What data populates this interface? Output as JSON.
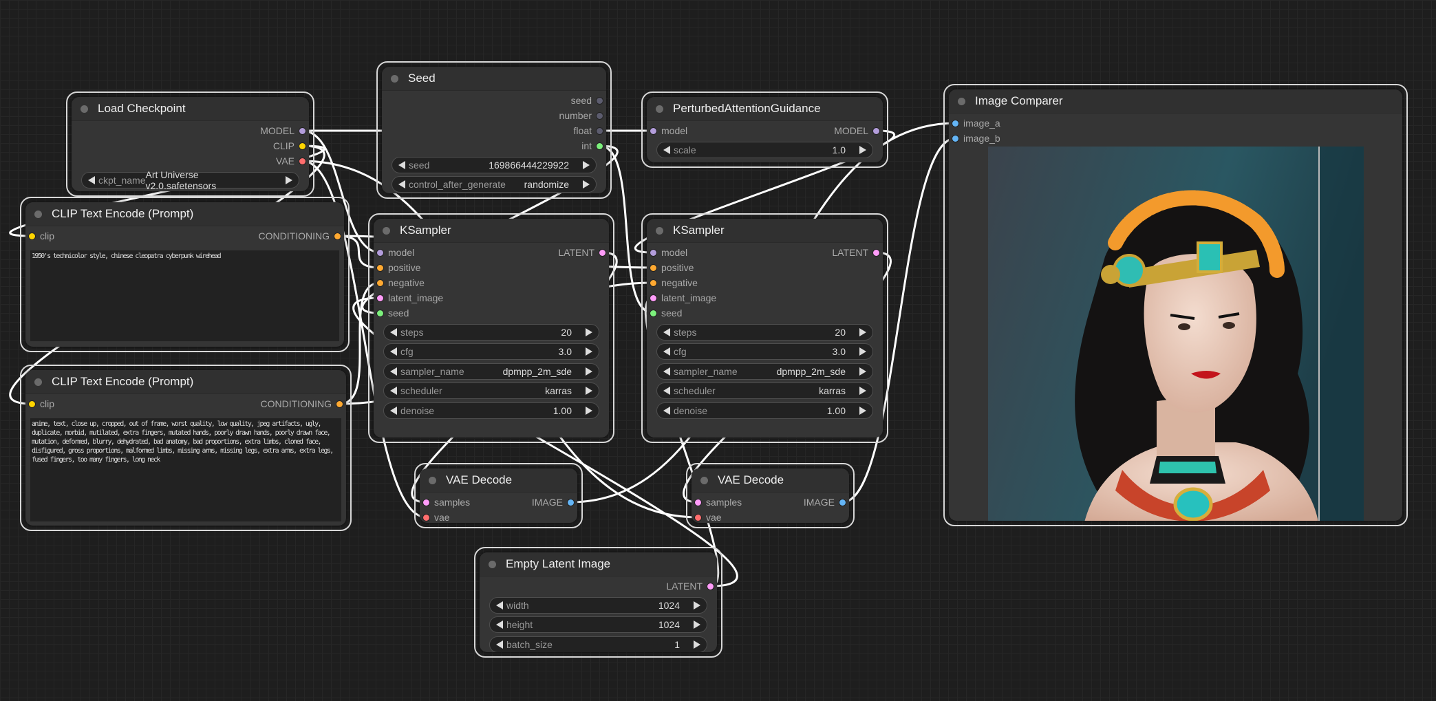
{
  "colors": {
    "MODEL": "#b39ddb",
    "CLIP": "#ffd500",
    "VAE": "#ff6e6e",
    "CONDITIONING": "#ffa931",
    "LATENT": "#ff9cf9",
    "IMAGE": "#64b5f6",
    "INT": "#7cf07c",
    "NUMBER": "#5c5c6e",
    "wire": "#ffffff",
    "canvas": "#1e1e1e"
  },
  "nodes": [
    {
      "id": "ckpt",
      "title": "Load Checkpoint",
      "inputs": [],
      "outputs": [
        {
          "name": "MODEL",
          "type": "MODEL"
        },
        {
          "name": "CLIP",
          "type": "CLIP"
        },
        {
          "name": "VAE",
          "type": "VAE"
        }
      ],
      "widgets": [
        {
          "label": "ckpt_name",
          "value": "Art Universe v2.0.safetensors"
        }
      ]
    },
    {
      "id": "seed",
      "title": "Seed",
      "inputs": [],
      "outputs": [
        {
          "name": "seed",
          "type": "NUMBER"
        },
        {
          "name": "number",
          "type": "NUMBER"
        },
        {
          "name": "float",
          "type": "NUMBER"
        },
        {
          "name": "int",
          "type": "INT"
        }
      ],
      "widgets": [
        {
          "label": "seed",
          "value": "169866444229922"
        },
        {
          "label": "control_after_generate",
          "value": "randomize"
        }
      ]
    },
    {
      "id": "pag",
      "title": "PerturbedAttentionGuidance",
      "inputs": [
        {
          "name": "model",
          "type": "MODEL"
        }
      ],
      "outputs": [
        {
          "name": "MODEL",
          "type": "MODEL"
        }
      ],
      "widgets": [
        {
          "label": "scale",
          "value": "1.0"
        }
      ]
    },
    {
      "id": "cmp",
      "title": "Image Comparer",
      "inputs": [
        {
          "name": "image_a",
          "type": "IMAGE"
        },
        {
          "name": "image_b",
          "type": "IMAGE"
        }
      ],
      "outputs": [],
      "widgets": [],
      "image": true
    },
    {
      "id": "clip1",
      "title": "CLIP Text Encode (Prompt)",
      "inputs": [
        {
          "name": "clip",
          "type": "CLIP"
        }
      ],
      "outputs": [
        {
          "name": "CONDITIONING",
          "type": "CONDITIONING"
        }
      ],
      "widgets": [],
      "text": "1950's technicolor style, chinese cleopatra cyberpunk wirehead"
    },
    {
      "id": "clip2",
      "title": "CLIP Text Encode (Prompt)",
      "inputs": [
        {
          "name": "clip",
          "type": "CLIP"
        }
      ],
      "outputs": [
        {
          "name": "CONDITIONING",
          "type": "CONDITIONING"
        }
      ],
      "widgets": [],
      "text": "anime, text, close up, cropped, out of frame, worst quality, low quality, jpeg artifacts, ugly, duplicate, morbid, mutilated, extra fingers, mutated hands, poorly drawn hands, poorly drawn face, mutation, deformed, blurry, dehydrated, bad anatomy, bad proportions, extra limbs, cloned face, disfigured, gross proportions, malformed limbs, missing arms, missing legs, extra arms, extra legs, fused fingers, too many fingers, long neck"
    },
    {
      "id": "ks1",
      "title": "KSampler",
      "inputs": [
        {
          "name": "model",
          "type": "MODEL"
        },
        {
          "name": "positive",
          "type": "CONDITIONING"
        },
        {
          "name": "negative",
          "type": "CONDITIONING"
        },
        {
          "name": "latent_image",
          "type": "LATENT"
        },
        {
          "name": "seed",
          "type": "INT"
        }
      ],
      "outputs": [
        {
          "name": "LATENT",
          "type": "LATENT"
        }
      ],
      "widgets": [
        {
          "label": "steps",
          "value": "20"
        },
        {
          "label": "cfg",
          "value": "3.0"
        },
        {
          "label": "sampler_name",
          "value": "dpmpp_2m_sde"
        },
        {
          "label": "scheduler",
          "value": "karras"
        },
        {
          "label": "denoise",
          "value": "1.00"
        }
      ]
    },
    {
      "id": "ks2",
      "title": "KSampler",
      "inputs": [
        {
          "name": "model",
          "type": "MODEL"
        },
        {
          "name": "positive",
          "type": "CONDITIONING"
        },
        {
          "name": "negative",
          "type": "CONDITIONING"
        },
        {
          "name": "latent_image",
          "type": "LATENT"
        },
        {
          "name": "seed",
          "type": "INT"
        }
      ],
      "outputs": [
        {
          "name": "LATENT",
          "type": "LATENT"
        }
      ],
      "widgets": [
        {
          "label": "steps",
          "value": "20"
        },
        {
          "label": "cfg",
          "value": "3.0"
        },
        {
          "label": "sampler_name",
          "value": "dpmpp_2m_sde"
        },
        {
          "label": "scheduler",
          "value": "karras"
        },
        {
          "label": "denoise",
          "value": "1.00"
        }
      ]
    },
    {
      "id": "vae1",
      "title": "VAE Decode",
      "inputs": [
        {
          "name": "samples",
          "type": "LATENT"
        },
        {
          "name": "vae",
          "type": "VAE"
        }
      ],
      "outputs": [
        {
          "name": "IMAGE",
          "type": "IMAGE"
        }
      ],
      "widgets": []
    },
    {
      "id": "vae2",
      "title": "VAE Decode",
      "inputs": [
        {
          "name": "samples",
          "type": "LATENT"
        },
        {
          "name": "vae",
          "type": "VAE"
        }
      ],
      "outputs": [
        {
          "name": "IMAGE",
          "type": "IMAGE"
        }
      ],
      "widgets": []
    },
    {
      "id": "empty",
      "title": "Empty Latent Image",
      "inputs": [],
      "outputs": [
        {
          "name": "LATENT",
          "type": "LATENT"
        }
      ],
      "widgets": [
        {
          "label": "width",
          "value": "1024"
        },
        {
          "label": "height",
          "value": "1024"
        },
        {
          "label": "batch_size",
          "value": "1"
        }
      ]
    }
  ]
}
